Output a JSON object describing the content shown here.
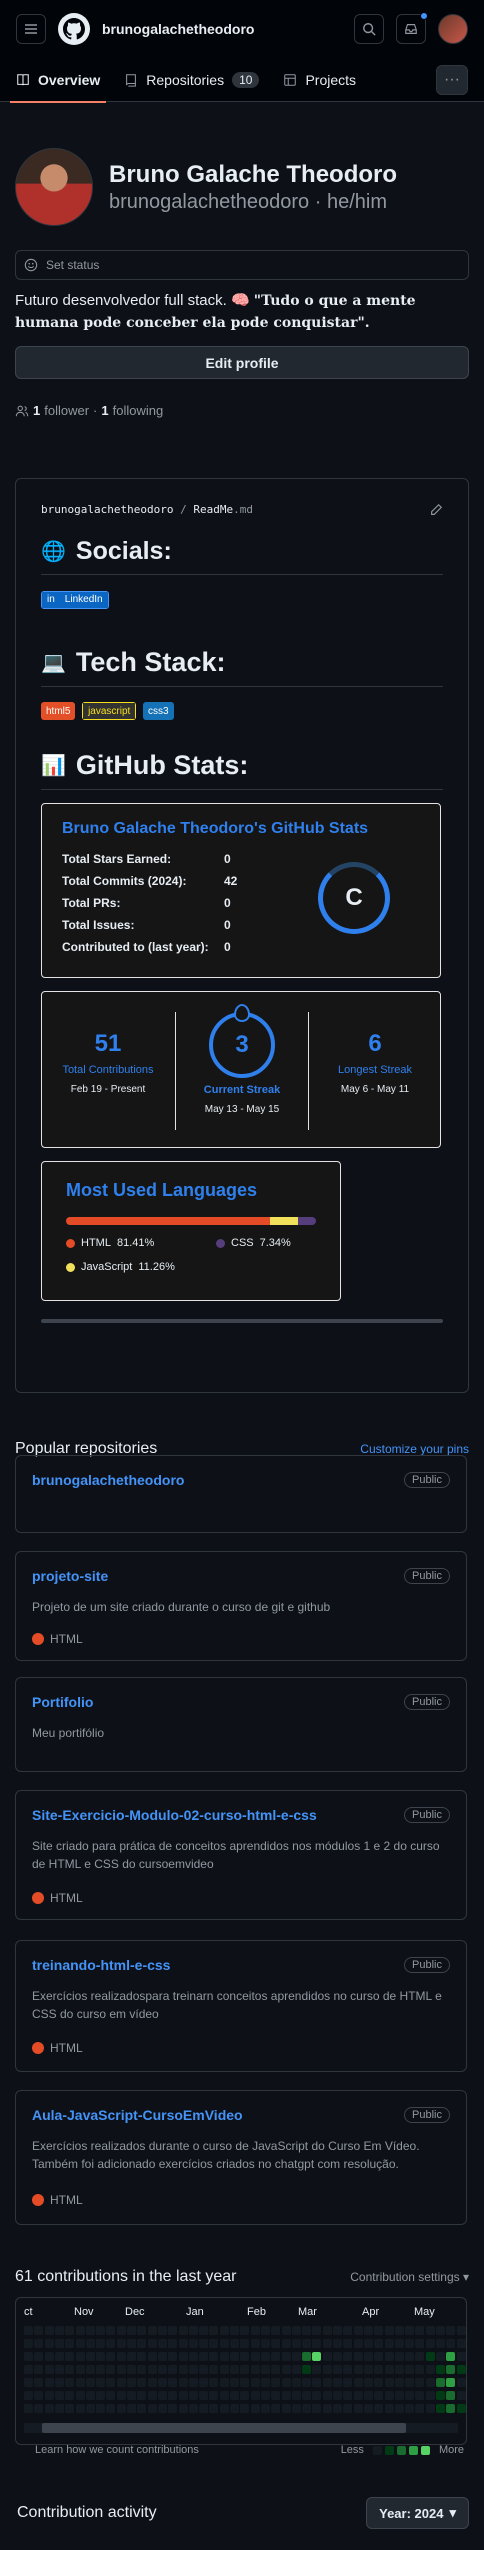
{
  "header": {
    "title": "brunogalachetheodoro",
    "menu_icon": "menu-icon",
    "logo": "github-logo-icon",
    "search_icon": "search-icon",
    "inbox_icon": "inbox-icon"
  },
  "tabs": [
    {
      "label": "Overview",
      "icon": "book-icon"
    },
    {
      "label": "Repositories",
      "icon": "repo-icon",
      "count": "10"
    },
    {
      "label": "Projects",
      "icon": "table-icon"
    }
  ],
  "more_label": "···",
  "profile": {
    "name": "Bruno Galache Theodoro",
    "login": "brunogalachetheodoro",
    "pronouns": "he/him",
    "status": "Set status",
    "bio_plain": "Futuro desenvolvedor full stack. 🧠 ",
    "bio_quote": "\"Tudo o que a mente humana pode conceber ela pode conquistar\".",
    "edit": "Edit profile",
    "followers": "1",
    "followers_label": "follower",
    "following": "1",
    "following_label": "following",
    "sep": "·"
  },
  "readme": {
    "path_user": "brunogalachetheodoro",
    "path_sep": "/",
    "path_file": "ReadMe",
    "path_ext": ".md",
    "socials_title": "Socials:",
    "socials_icon": "🌐",
    "linkedin": "LinkedIn",
    "tech_title": "Tech Stack:",
    "tech_icon": "💻",
    "tech": [
      {
        "label": "html5",
        "color": "#e34f26"
      },
      {
        "label": "javascript",
        "color": "#323330"
      },
      {
        "label": "css3",
        "color": "#1572b6"
      }
    ],
    "stats_title": "GitHub Stats:",
    "stats_icon": "📊"
  },
  "stats_card": {
    "title": "Bruno Galache Theodoro's GitHub Stats",
    "rows": [
      {
        "k": "Total Stars Earned:",
        "v": "0"
      },
      {
        "k": "Total Commits (2024):",
        "v": "42"
      },
      {
        "k": "Total PRs:",
        "v": "0"
      },
      {
        "k": "Total Issues:",
        "v": "0"
      },
      {
        "k": "Contributed to (last year):",
        "v": "0"
      }
    ],
    "rank": "C"
  },
  "streak": {
    "total": "51",
    "total_label": "Total Contributions",
    "total_range": "Feb 19 - Present",
    "current": "3",
    "current_label": "Current Streak",
    "current_range": "May 13 - May 15",
    "longest": "6",
    "longest_label": "Longest Streak",
    "longest_range": "May 6 - May 11"
  },
  "langs": {
    "title": "Most Used Languages",
    "items": [
      {
        "name": "HTML",
        "pct": "81.41%",
        "value": 81.41,
        "color": "#e34c26"
      },
      {
        "name": "CSS",
        "pct": "7.34%",
        "value": 7.34,
        "color": "#563d7c"
      },
      {
        "name": "JavaScript",
        "pct": "11.26%",
        "value": 11.26,
        "color": "#f1e05a"
      }
    ]
  },
  "popular": {
    "title": "Popular repositories",
    "customize": "Customize your pins",
    "public": "Public",
    "repos": [
      {
        "name": "brunogalachetheodoro",
        "desc": "",
        "lang": ""
      },
      {
        "name": "projeto-site",
        "desc": "Projeto de um site criado durante o curso de git e github",
        "lang": "HTML"
      },
      {
        "name": "Portifolio",
        "desc": "Meu portifólio",
        "lang": ""
      },
      {
        "name": "Site-Exercicio-Modulo-02-curso-html-e-css",
        "desc": "Site criado para prática de conceitos aprendidos nos módulos 1 e 2 do curso de HTML e CSS do cursoemvideo",
        "lang": "HTML"
      },
      {
        "name": "treinando-html-e-css",
        "desc": "Exercícios realizadospara treinarn conceitos aprendidos no curso de HTML e CSS do curso em vídeo",
        "lang": "HTML"
      },
      {
        "name": "Aula-JavaScript-CursoEmVideo",
        "desc": "Exercícios realizados durante o curso de JavaScript do Curso Em Vídeo. Também foi adicionado exercícios criados no chatgpt com resolução.",
        "lang": "HTML"
      }
    ],
    "html_color": "#e34c26"
  },
  "contrib": {
    "title": "61 contributions in the last year",
    "settings": "Contribution settings",
    "months": [
      "ct",
      "Nov",
      "Dec",
      "Jan",
      "Feb",
      "Mar",
      "Apr",
      "May"
    ],
    "learn": "Learn how we count contributions",
    "less": "Less",
    "more": "More"
  },
  "activity": {
    "title": "Contribution activity",
    "year": "Year: 2024"
  }
}
